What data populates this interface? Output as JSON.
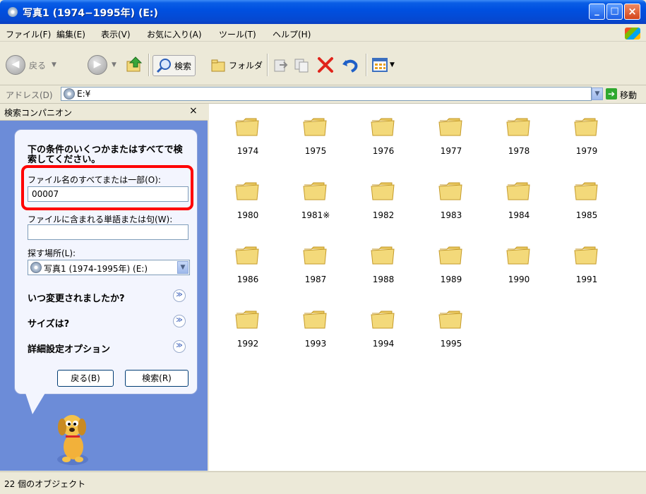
{
  "window": {
    "title": "写真1 (1974−1995年) (E:)",
    "min": "_",
    "max": "□",
    "close": "×"
  },
  "menu": [
    "ファイル(F)",
    "編集(E)",
    "表示(V)",
    "お気に入り(A)",
    "ツール(T)",
    "ヘルプ(H)"
  ],
  "toolbar": {
    "back": "戻る",
    "search": "検索",
    "folders": "フォルダ"
  },
  "address": {
    "label": "アドレス(D)",
    "value": "E:¥",
    "go": "移動"
  },
  "search_pane": {
    "title": "検索コンパニオン",
    "close": "×",
    "heading": "下の条件のいくつかまたはすべてで検索してください。",
    "filename_label": "ファイル名のすべてまたは一部(O):",
    "filename_value": "00007",
    "word_label": "ファイルに含まれる単語または句(W):",
    "word_value": "",
    "location_label": "探す場所(L):",
    "location_value": "写真1 (1974-1995年) (E:)",
    "options": [
      "いつ変更されましたか?",
      "サイズは?",
      "詳細設定オプション"
    ],
    "back_button": "戻る(B)",
    "search_button": "検索(R)"
  },
  "folders": [
    "1974",
    "1975",
    "1976",
    "1977",
    "1978",
    "1979",
    "1980",
    "1981※",
    "1982",
    "1983",
    "1984",
    "1985",
    "1986",
    "1987",
    "1988",
    "1989",
    "1990",
    "1991",
    "1992",
    "1993",
    "1994",
    "1995"
  ],
  "status": {
    "text": "22 個のオブジェクト"
  },
  "colors": {
    "titlebar": "#0050e0",
    "pane_bg": "#6c8cd8",
    "highlight": "#ff0000",
    "folder": "#f3d97a"
  }
}
